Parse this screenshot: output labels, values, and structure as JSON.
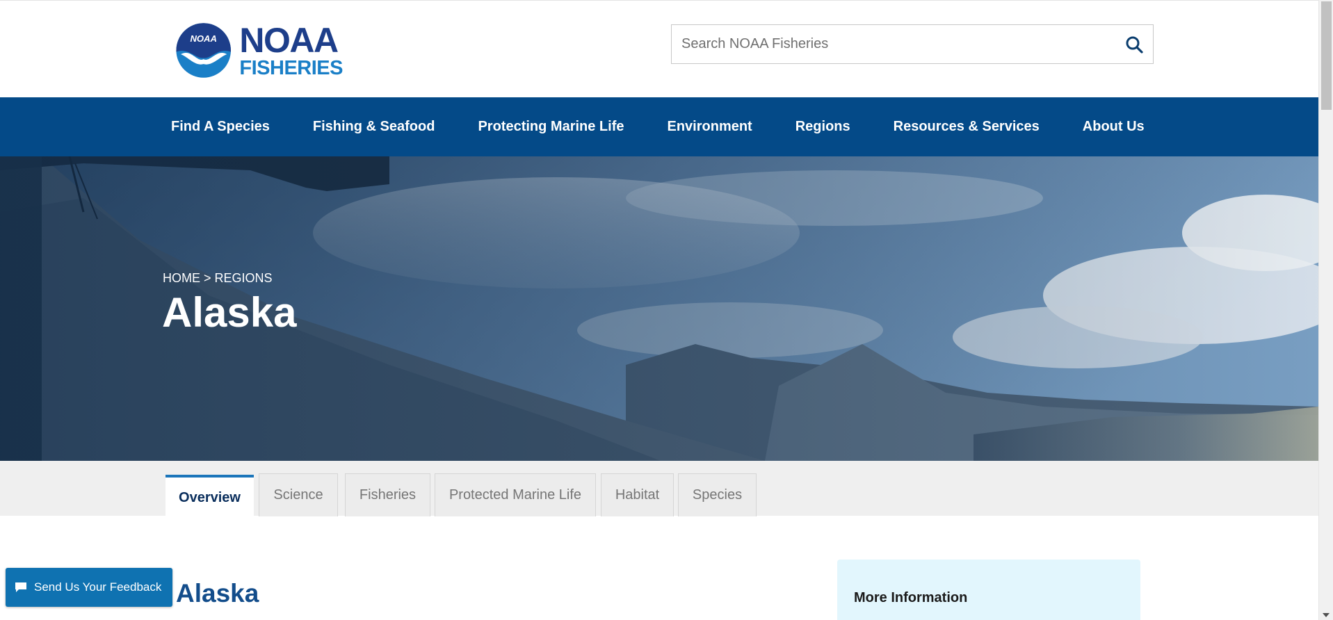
{
  "header": {
    "logo": {
      "line1": "NOAA",
      "line2": "FISHERIES",
      "emblem_text": "NOAA"
    },
    "search": {
      "placeholder": "Search NOAA Fisheries",
      "value": ""
    }
  },
  "nav": {
    "items": [
      {
        "label": "Find A Species"
      },
      {
        "label": "Fishing & Seafood"
      },
      {
        "label": "Protecting Marine Life"
      },
      {
        "label": "Environment"
      },
      {
        "label": "Regions"
      },
      {
        "label": "Resources & Services"
      },
      {
        "label": "About Us"
      }
    ]
  },
  "hero": {
    "breadcrumb": {
      "home": "HOME",
      "separator": ">",
      "current": "REGIONS"
    },
    "title": "Alaska"
  },
  "tabs": [
    {
      "label": "Overview",
      "active": true
    },
    {
      "label": "Science",
      "active": false
    },
    {
      "label": "Fisheries",
      "active": false
    },
    {
      "label": "Protected Marine Life",
      "active": false
    },
    {
      "label": "Habitat",
      "active": false
    },
    {
      "label": "Species",
      "active": false
    }
  ],
  "main": {
    "title": "Alaska"
  },
  "sidebar": {
    "title": "More Information"
  },
  "feedback": {
    "label": "Send Us Your Feedback"
  },
  "colors": {
    "nav_bg": "#044a88",
    "brand_dark_blue": "#1d3e8a",
    "brand_light_blue": "#1a7fc7",
    "tab_accent": "#1b75ba",
    "feedback_bg": "#0f72b1",
    "sidebar_bg": "#e2f6fd"
  },
  "icons": {
    "search": "search-icon",
    "feedback": "chat-bubble-icon"
  }
}
